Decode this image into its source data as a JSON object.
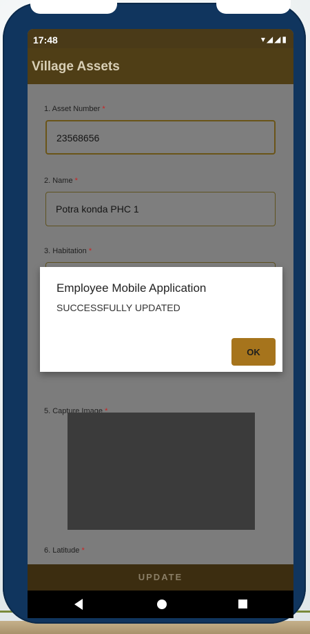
{
  "status": {
    "time": "17:48",
    "icons": "▾◢◢▮"
  },
  "appbar": {
    "title": "Village Assets"
  },
  "form": {
    "fields": [
      {
        "label": "1. Asset Number",
        "required_mark": "*",
        "value": "23568656"
      },
      {
        "label": "2. Name",
        "required_mark": "*",
        "value": "Potra konda PHC 1"
      },
      {
        "label": "3. Habitation",
        "required_mark": "*",
        "value": ""
      },
      {
        "label": "5. Capture Image",
        "required_mark": "*"
      },
      {
        "label": "6. Latitude",
        "required_mark": "*"
      }
    ],
    "update_label": "UPDATE"
  },
  "dialog": {
    "title": "Employee Mobile Application",
    "message": "SUCCESSFULLY UPDATED",
    "ok_label": "OK"
  },
  "colors": {
    "phone_frame": "#10355e",
    "app_bar": "#4f3e16",
    "accent_button": "#a6741c"
  },
  "icons": [
    "back-icon",
    "home-icon",
    "recents-icon",
    "wifi-icon",
    "signal-icon",
    "battery-icon"
  ]
}
